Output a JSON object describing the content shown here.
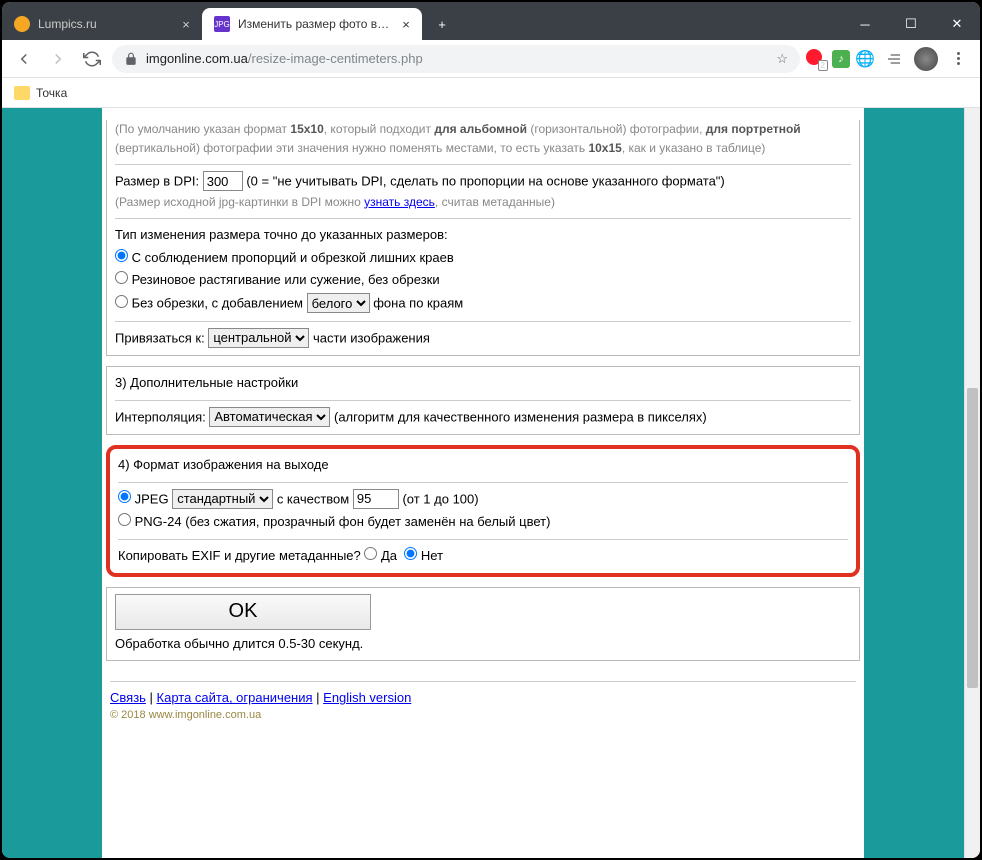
{
  "tabs": [
    {
      "title": "Lumpics.ru",
      "favicon_color": "#f5a623"
    },
    {
      "title": "Изменить размер фото в санти",
      "favicon_color": "#6633cc"
    }
  ],
  "url_host": "imgonline.com.ua",
  "url_path": "/resize-image-centimeters.php",
  "bookmark": "Точка",
  "section2": {
    "note_prefix": "(По умолчанию указан формат ",
    "bold1": "15x10",
    "mid1": ", который подходит ",
    "bold2": "для альбомной",
    "mid2": " (горизонтальной) фотографии, ",
    "bold3": "для портретной",
    "mid3": " (вертикальной) фотографии эти значения нужно поменять местами, то есть указать ",
    "bold4": "10x15",
    "mid4": ", как и указано в таблице)",
    "dpi_label": "Размер в DPI:",
    "dpi_value": "300",
    "dpi_hint": "(0 = \"не учитывать DPI, сделать по пропорции на основе указанного формата\")",
    "dpi_sub_prefix": "(Размер исходной jpg-картинки в DPI можно ",
    "dpi_sub_link": "узнать здесь",
    "dpi_sub_suffix": ", считав метаданные)",
    "resize_type_label": "Тип изменения размера точно до указанных размеров:",
    "opt1": "С соблюдением пропорций и обрезкой лишних краев",
    "opt2": "Резиновое растягивание или сужение, без обрезки",
    "opt3_prefix": "Без обрезки, с добавлением ",
    "opt3_select": "белого",
    "opt3_suffix": " фона по краям",
    "anchor_label": "Привязаться к: ",
    "anchor_select": "центральной",
    "anchor_suffix": " части изображения"
  },
  "section3": {
    "title": "3) Дополнительные настройки",
    "interp_label": "Интерполяция: ",
    "interp_select": "Автоматическая",
    "interp_hint": " (алгоритм для качественного изменения размера в пикселях)"
  },
  "section4": {
    "title": "4) Формат изображения на выходе",
    "jpeg_label": "JPEG ",
    "jpeg_select": "стандартный",
    "jpeg_mid": " с качеством ",
    "jpeg_q": "95",
    "jpeg_hint": " (от 1 до 100)",
    "png_label": "PNG-24 (без сжатия, прозрачный фон будет заменён на белый цвет)",
    "exif_label": "Копировать EXIF и другие метаданные?  ",
    "yes": "Да",
    "no": "Нет"
  },
  "submit": {
    "ok": "OK",
    "note": "Обработка обычно длится 0.5-30 секунд."
  },
  "footer": {
    "link1": "Связь",
    "link2": "Карта сайта, ограничения",
    "link3": "English version",
    "copyright": "© 2018 www.imgonline.com.ua"
  },
  "ext_badge": "2"
}
